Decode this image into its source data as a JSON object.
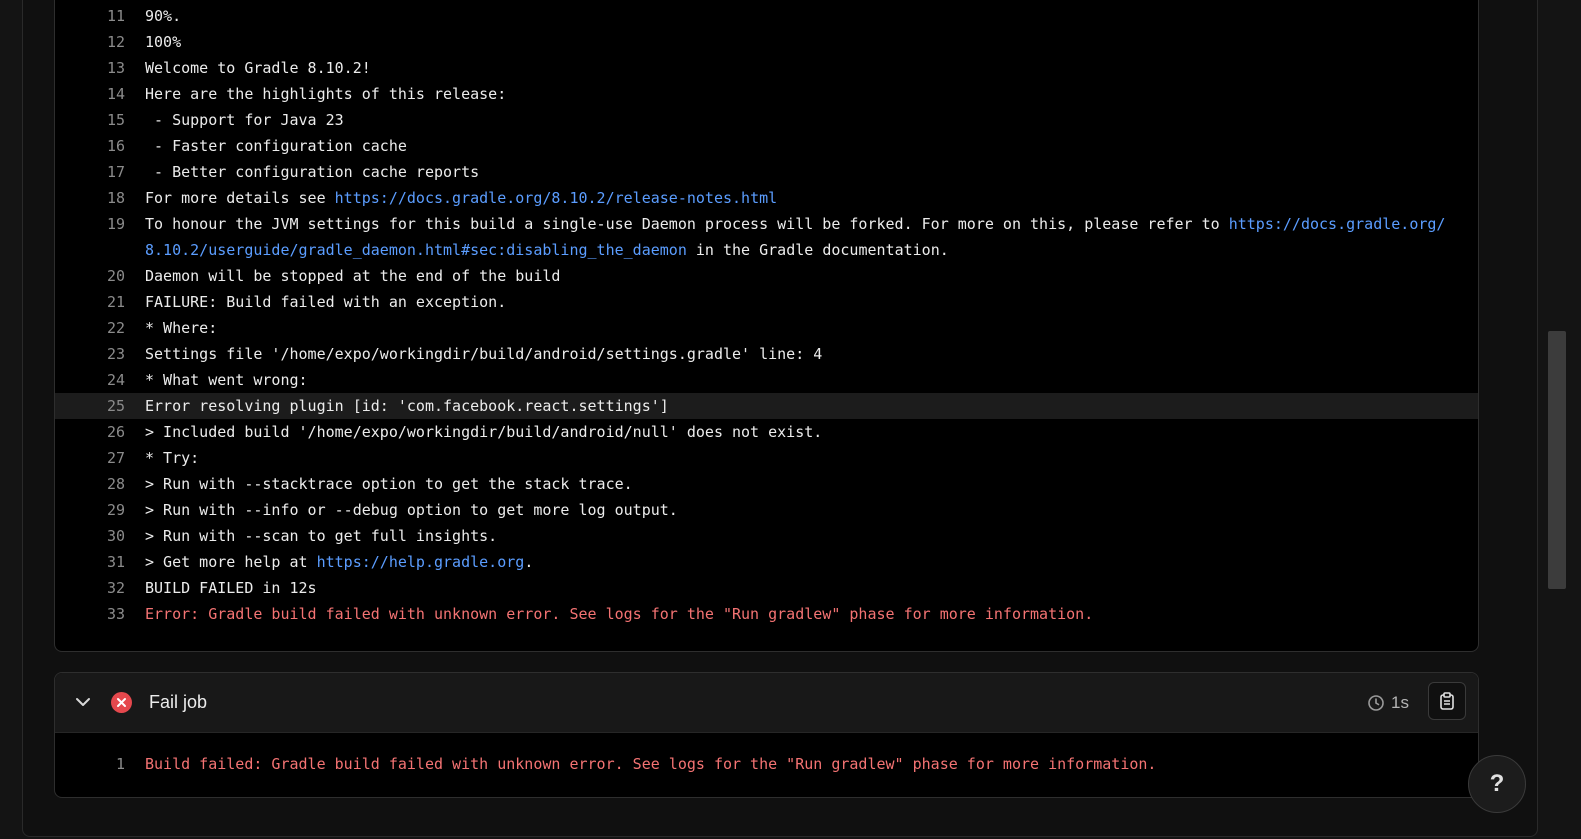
{
  "log": {
    "highlighted_line": "25",
    "lines": [
      {
        "n": "11",
        "text": "90%."
      },
      {
        "n": "12",
        "text": "100%"
      },
      {
        "n": "13",
        "text": "Welcome to Gradle 8.10.2!"
      },
      {
        "n": "14",
        "text": "Here are the highlights of this release:"
      },
      {
        "n": "15",
        "text": " - Support for Java 23"
      },
      {
        "n": "16",
        "text": " - Faster configuration cache"
      },
      {
        "n": "17",
        "text": " - Better configuration cache reports"
      },
      {
        "n": "18",
        "text": "For more details see ",
        "link": "https://docs.gradle.org/8.10.2/release-notes.html",
        "after": ""
      },
      {
        "n": "19",
        "text": "To honour the JVM settings for this build a single-use Daemon process will be forked. For more on this, please refer to ",
        "link": "https://docs.gradle.org/8.10.2/userguide/gradle_daemon.html#sec:disabling_the_daemon",
        "after": " in the Gradle documentation."
      },
      {
        "n": "20",
        "text": "Daemon will be stopped at the end of the build"
      },
      {
        "n": "21",
        "text": "FAILURE: Build failed with an exception."
      },
      {
        "n": "22",
        "text": "* Where:"
      },
      {
        "n": "23",
        "text": "Settings file '/home/expo/workingdir/build/android/settings.gradle' line: 4"
      },
      {
        "n": "24",
        "text": "* What went wrong:"
      },
      {
        "n": "25",
        "text": "Error resolving plugin [id: 'com.facebook.react.settings']"
      },
      {
        "n": "26",
        "text": "> Included build '/home/expo/workingdir/build/android/null' does not exist."
      },
      {
        "n": "27",
        "text": "* Try:"
      },
      {
        "n": "28",
        "text": "> Run with --stacktrace option to get the stack trace."
      },
      {
        "n": "29",
        "text": "> Run with --info or --debug option to get more log output."
      },
      {
        "n": "30",
        "text": "> Run with --scan to get full insights."
      },
      {
        "n": "31",
        "text": "> Get more help at ",
        "link": "https://help.gradle.org",
        "after": "."
      },
      {
        "n": "32",
        "text": "BUILD FAILED in 12s"
      },
      {
        "n": "33",
        "text": "Error: Gradle build failed with unknown error. See logs for the \"Run gradlew\" phase for more information.",
        "error": true
      }
    ]
  },
  "fail_job": {
    "title": "Fail job",
    "duration": "1s",
    "status_color": "#e5484d",
    "icons": {
      "collapse": "chevron-down-icon",
      "status": "error-x-icon",
      "duration": "clock-icon",
      "copy": "clipboard-icon"
    },
    "lines": [
      {
        "n": "1",
        "text": "Build failed: Gradle build failed with unknown error. See logs for the \"Run gradlew\" phase for more information.",
        "error": true
      }
    ]
  },
  "help_button": {
    "label": "?"
  },
  "colors": {
    "link": "#5b9dff",
    "error_text": "#f47373",
    "background": "#000000"
  }
}
